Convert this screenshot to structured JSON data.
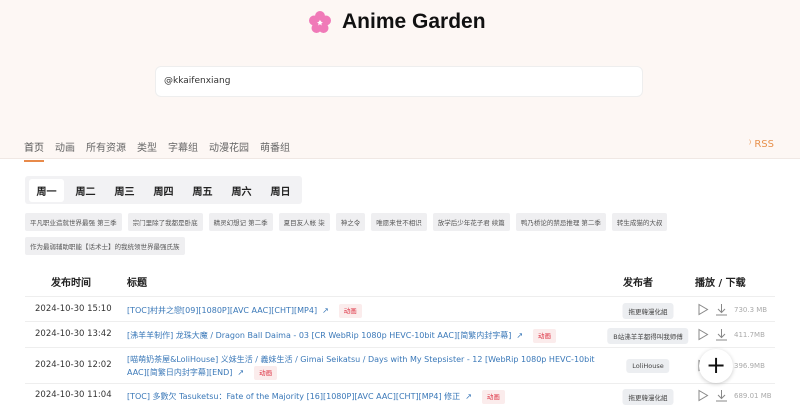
{
  "header": {
    "title": "Anime Garden",
    "search_value": "@kkaifenxiang"
  },
  "nav": {
    "items": [
      "首页",
      "动画",
      "所有资源",
      "类型",
      "字幕组",
      "动漫花园",
      "萌番组"
    ],
    "rss": "RSS"
  },
  "week": [
    "周一",
    "周二",
    "周三",
    "周四",
    "周五",
    "周六",
    "周日"
  ],
  "tags": [
    "平凡职业造就世界最强 第三季",
    "宗门里除了我都是卧底",
    "精灵幻想记 第二季",
    "夏目友人帐 柒",
    "神之令",
    "唯愿来世不相识",
    "放学后少年花子君 续篇",
    "鸭乃桥论的禁忌推理 第二季",
    "转生成猫的大叔",
    "作为最弱辅助职能【话术士】的我统领世界最强氏族"
  ],
  "table": {
    "headers": [
      "发布时间",
      "标题",
      "发布者",
      "播放 / 下载"
    ],
    "rows": [
      {
        "date": "2024-10-30 15:10",
        "title": "[TOC]村井之戀[09][1080P][AVC AAC][CHT][MP4]",
        "category": "动画",
        "publisher": "拖更韓漫化組",
        "size": "730.3 MB"
      },
      {
        "date": "2024-10-30 13:42",
        "title": "[沸羊羊制作] 龙珠大魔 / Dragon Ball Daima - 03 [CR WebRip 1080p HEVC-10bit AAC][简繁内封字幕]",
        "category": "动画",
        "publisher": "B站沸羊羊都得叫我师傅",
        "size": "411.7MB"
      },
      {
        "date": "2024-10-30 12:02",
        "title": "[喵萌奶茶屋&LoliHouse] 义妹生活 / 義妹生活 / Gimai Seikatsu / Days with My Stepsister - 12 [WebRip 1080p HEVC-10bit AAC][简繁日内封字幕][END]",
        "category": "动画",
        "publisher": "LoliHouse",
        "size": "396.9MB"
      },
      {
        "date": "2024-10-30 11:04",
        "title": "[TOC] 多數欠 Tasuketsu：Fate of the Majority [16][1080P][AVC AAC][CHT][MP4] 修正",
        "category": "动画",
        "publisher": "拖更韓漫化組",
        "size": "689.01 MB"
      }
    ]
  },
  "colors": {
    "accent": "#e88a4a",
    "link": "#3a78b8",
    "logo": "#f07ab8"
  }
}
